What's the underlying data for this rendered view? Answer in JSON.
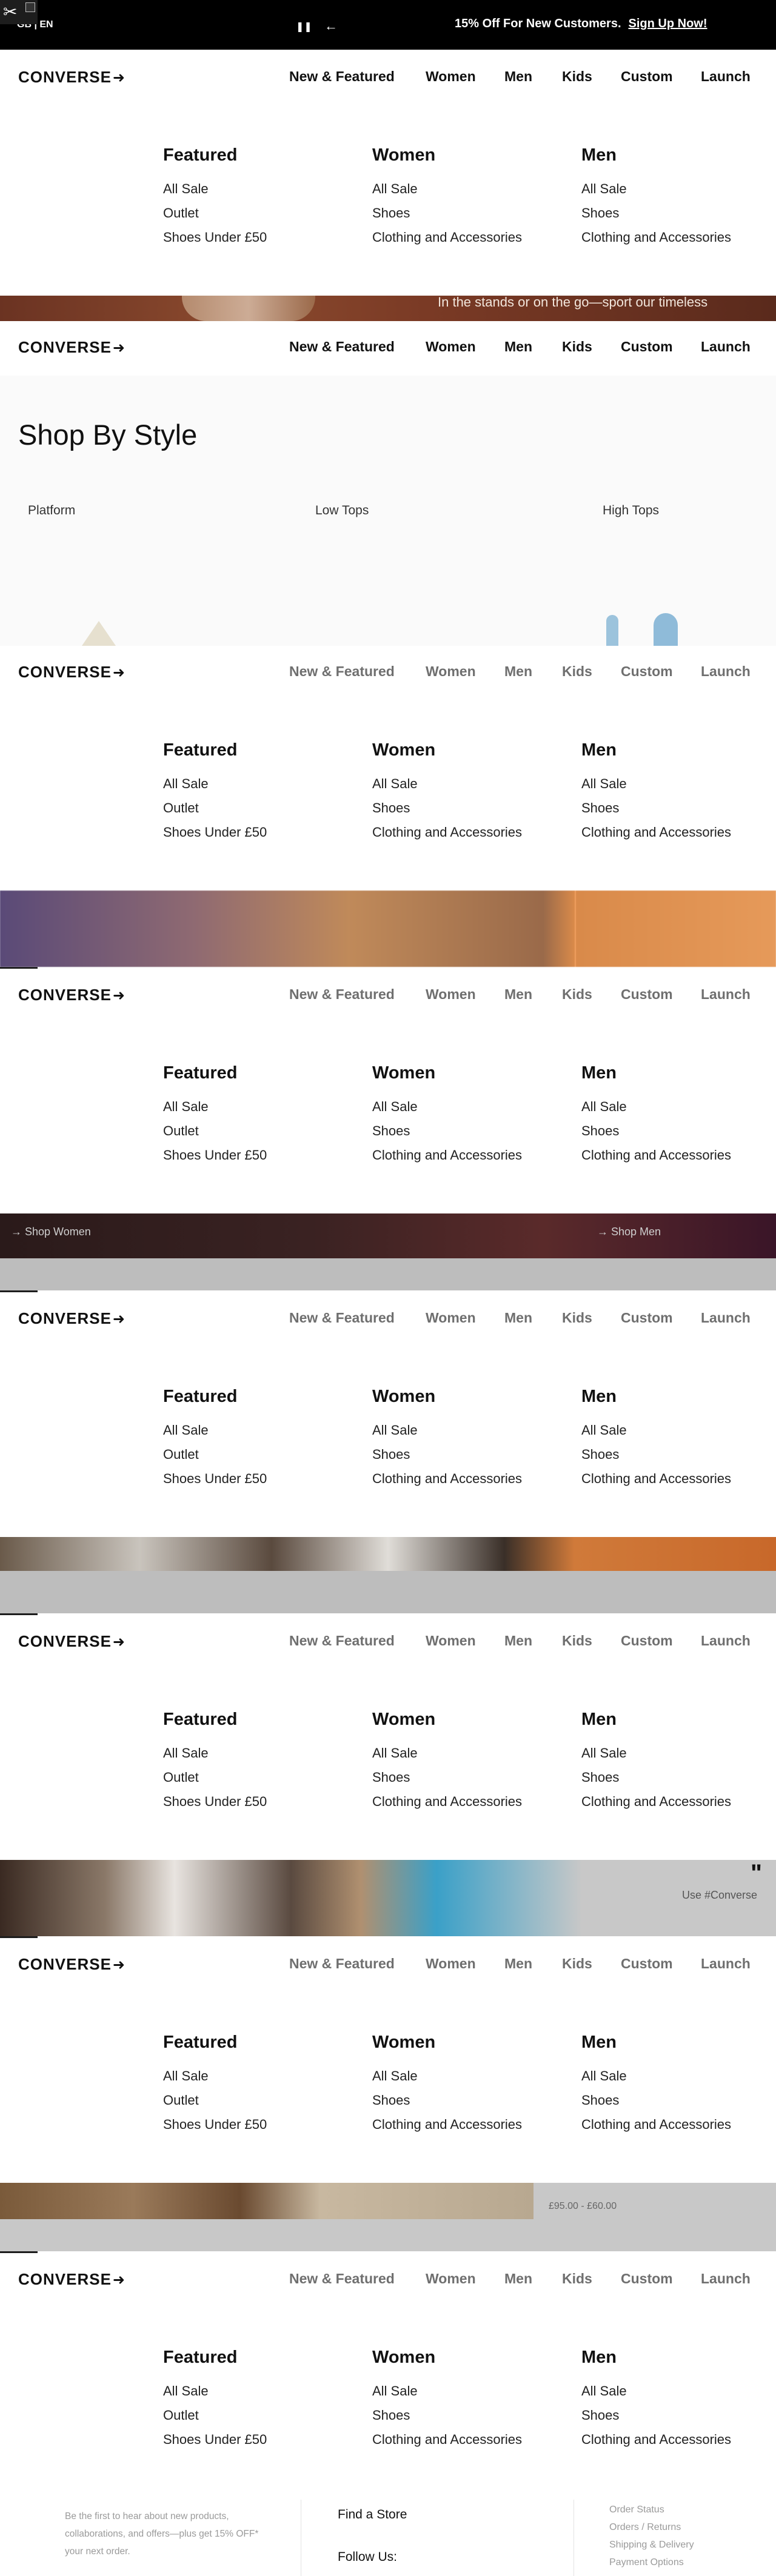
{
  "promo": {
    "locale": "GB | EN",
    "pause": "❚❚",
    "back": "←",
    "message": "15% Off For New Customers.",
    "link": "Sign Up Now!"
  },
  "brand": {
    "logo": "CONVERSE",
    "arrow": "➜"
  },
  "nav": [
    "New & Featured",
    "Women",
    "Men",
    "Kids",
    "Custom",
    "Launch"
  ],
  "menu": {
    "featured": {
      "title": "Featured",
      "links": [
        "All Sale",
        "Outlet",
        "Shoes Under £50"
      ]
    },
    "women": {
      "title": "Women",
      "links": [
        "All Sale",
        "Shoes",
        "Clothing and Accessories"
      ]
    },
    "men": {
      "title": "Men",
      "links": [
        "All Sale",
        "Shoes",
        "Clothing and Accessories"
      ]
    }
  },
  "hero_text": "In the stands or on the go—sport our timeless",
  "shop_by_style": {
    "title": "Shop By Style",
    "styles": [
      "Platform",
      "Low Tops",
      "High Tops"
    ]
  },
  "strips": {
    "women_cta": "Shop Women",
    "men_cta": "Shop Men",
    "hashtag": "Use #Converse",
    "price_line": "£95.00 - £60.00"
  },
  "footer": {
    "signup_blurb": "Be the first to hear about new products, collaborations, and offers—plus get 15% OFF* your next order.",
    "find_store": "Find a Store",
    "follow_us": "Follow Us:",
    "links": [
      "Order Status",
      "Orders / Returns",
      "Shipping & Delivery",
      "Payment Options"
    ]
  },
  "colors": {
    "promo_bg": "#000000",
    "nav_active": "#111111",
    "nav_dim": "#6f6f6f",
    "footer_muted": "#9a9a9a"
  }
}
